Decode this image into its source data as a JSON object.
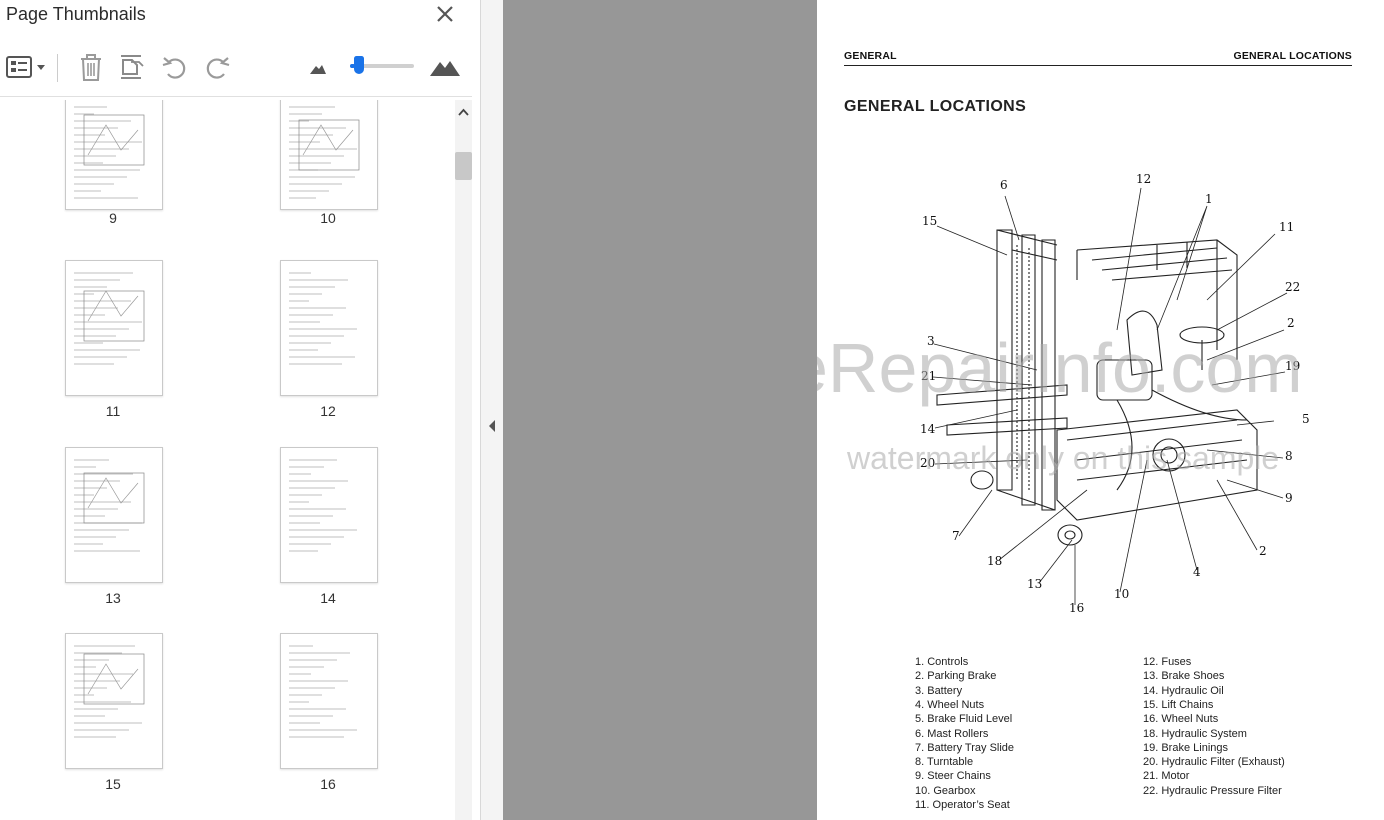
{
  "panel": {
    "title": "Page Thumbnails",
    "icons": [
      "page-options-icon",
      "trash-icon",
      "insert-page-icon",
      "rotate-left-icon",
      "rotate-right-icon",
      "small-mountain-icon",
      "large-mountain-icon"
    ],
    "zoom_slider_level": 0.08,
    "thumbnails": [
      {
        "page": "9"
      },
      {
        "page": "10"
      },
      {
        "page": "11"
      },
      {
        "page": "12"
      },
      {
        "page": "13"
      },
      {
        "page": "14"
      },
      {
        "page": "15"
      },
      {
        "page": "16"
      }
    ]
  },
  "document": {
    "header_left": "GENERAL",
    "header_right": "GENERAL LOCATIONS",
    "heading": "GENERAL LOCATIONS",
    "callouts": [
      "6",
      "12",
      "1",
      "15",
      "11",
      "22",
      "3",
      "2",
      "21",
      "19",
      "14",
      "5",
      "20",
      "8",
      "9",
      "7",
      "18",
      "2",
      "13",
      "4",
      "16",
      "10"
    ],
    "legend_left": [
      "1.  Controls",
      "2.  Parking Brake",
      "3.  Battery",
      "4.  Wheel Nuts",
      "5.  Brake Fluid Level",
      "6.  Mast Rollers",
      "7.  Battery Tray Slide",
      "8.  Turntable",
      "9.  Steer Chains",
      "10.  Gearbox",
      "11.  Operator’s Seat"
    ],
    "legend_right": [
      "12.  Fuses",
      "13.  Brake Shoes",
      "14.  Hydraulic Oil",
      "15.  Lift Chains",
      "16.  Wheel Nuts",
      "18.  Hydraulic System",
      "19.  Brake Linings",
      "20.  Hydraulic Filter (Exhaust)",
      "21.  Motor",
      "22.  Hydraulic Pressure Filter"
    ],
    "watermark_main": "eRepairInfo.com",
    "watermark_sub": "watermark only on this sample"
  },
  "colors": {
    "accent": "#1a73e8",
    "gray_area": "#979797",
    "icon": "#8a8a8a"
  }
}
